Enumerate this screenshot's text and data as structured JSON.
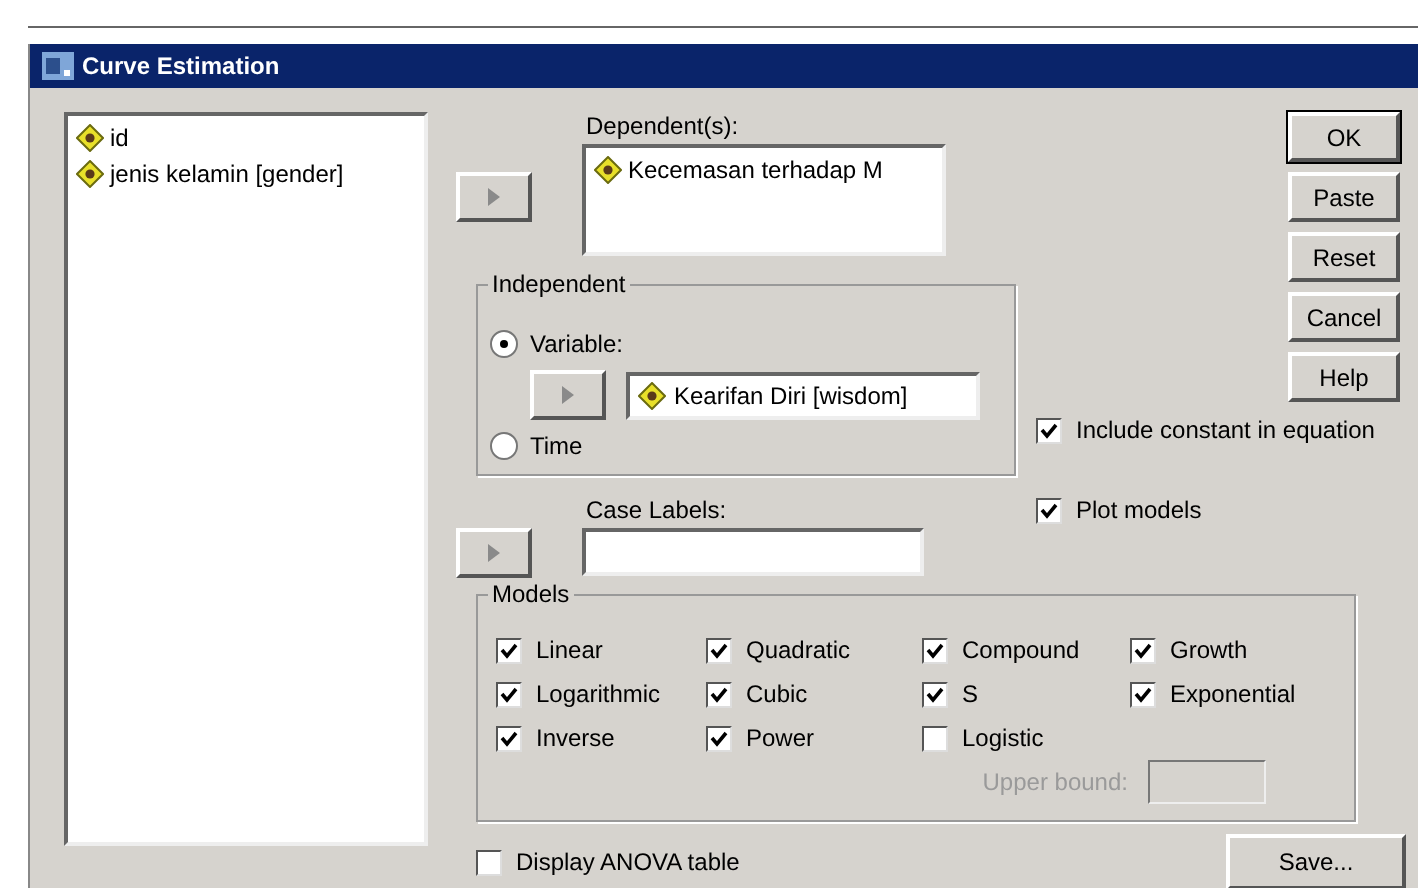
{
  "window": {
    "title": "Curve Estimation"
  },
  "variables": [
    "id",
    "jenis kelamin [gender]"
  ],
  "dependents": {
    "label": "Dependent(s):",
    "items": [
      "Kecemasan terhadap M"
    ]
  },
  "independent": {
    "title": "Independent",
    "options": [
      {
        "label": "Variable:",
        "selected": true
      },
      {
        "label": "Time",
        "selected": false
      }
    ],
    "variable": "Kearifan Diri [wisdom]"
  },
  "case_labels": {
    "label": "Case Labels:"
  },
  "buttons": [
    "OK",
    "Paste",
    "Reset",
    "Cancel",
    "Help"
  ],
  "options": [
    {
      "label": "Include constant in equation",
      "checked": true
    },
    {
      "label": "Plot models",
      "checked": true
    }
  ],
  "models": {
    "title": "Models",
    "items": [
      {
        "label": "Linear",
        "checked": true
      },
      {
        "label": "Quadratic",
        "checked": true
      },
      {
        "label": "Compound",
        "checked": true
      },
      {
        "label": "Growth",
        "checked": true
      },
      {
        "label": "Logarithmic",
        "checked": true
      },
      {
        "label": "Cubic",
        "checked": true
      },
      {
        "label": "S",
        "checked": true
      },
      {
        "label": "Exponential",
        "checked": true
      },
      {
        "label": "Inverse",
        "checked": true
      },
      {
        "label": "Power",
        "checked": true
      },
      {
        "label": "Logistic",
        "checked": false
      }
    ],
    "upper_bound": {
      "label": "Upper bound:",
      "disabled": true
    }
  },
  "display_anova": {
    "label": "Display ANOVA table",
    "checked": false
  },
  "save_button": "Save..."
}
